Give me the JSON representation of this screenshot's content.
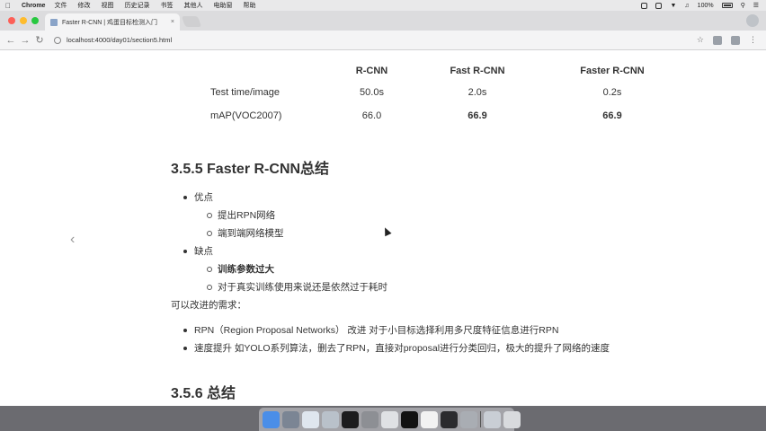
{
  "menubar": {
    "app": "Chrome",
    "items": [
      "文件",
      "修改",
      "视图",
      "历史记录",
      "书签",
      "其他人",
      "电助窗",
      "帮助"
    ],
    "battery": "100%"
  },
  "tab": {
    "title": "Faster R-CNN | 鸡蛋目标检测入门"
  },
  "address": {
    "url": "localhost:4000/day01/section5.html"
  },
  "table": {
    "headers": [
      "",
      "R-CNN",
      "Fast R-CNN",
      "Faster R-CNN"
    ],
    "rows": [
      [
        "Test time/image",
        "50.0s",
        "2.0s",
        "0.2s"
      ],
      [
        "mAP(VOC2007)",
        "66.0",
        "66.9",
        "66.9"
      ]
    ]
  },
  "section355": {
    "title": "3.5.5 Faster R-CNN总结",
    "items": [
      {
        "level": 1,
        "text": "优点"
      },
      {
        "level": 2,
        "text": "提出RPN网络"
      },
      {
        "level": 2,
        "text": "端到端网络模型"
      },
      {
        "level": 1,
        "text": "缺点"
      },
      {
        "level": 2,
        "text": "训练参数过大",
        "bold": true
      },
      {
        "level": 2,
        "text": "对于真实训练使用来说还是依然过于耗时"
      }
    ]
  },
  "improve": {
    "label": "可以改进的需求：",
    "items": [
      "RPN（Region Proposal Networks） 改进 对于小目标选择利用多尺度特征信息进行RPN",
      "速度提升 如YOLO系列算法，删去了RPN，直接对proposal进行分类回归，极大的提升了网络的速度"
    ]
  },
  "section356": {
    "title": "3.5.6 总结"
  },
  "colors": {
    "traffic_close": "#fd5f57",
    "traffic_min": "#febc2e",
    "traffic_max": "#28c840"
  }
}
